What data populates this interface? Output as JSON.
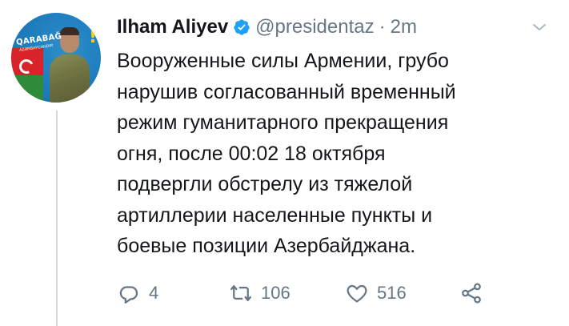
{
  "tweet": {
    "display_name": "Ilham Aliyev",
    "handle": "@presidentaz",
    "separator": "·",
    "time": "2m",
    "text_lines": [
      "Вооруженные силы Армении, грубо",
      "нарушив согласованный временный",
      "режим гуманитарного прекращения",
      "огня, после 00:02 18 октября",
      "подвергли обстрелу из тяжелой",
      "артиллерии населенные пункты и",
      "боевые позиции Азербайджана."
    ]
  },
  "avatar": {
    "banner_text": "QARABAĞ",
    "banner_sub": "AZƏRBAYCANDIR",
    "exclamation": "!"
  },
  "actions": {
    "reply_count": "4",
    "retweet_count": "106",
    "like_count": "516"
  },
  "icons": {
    "verified": "verified-badge-icon",
    "caret": "chevron-down-icon",
    "reply": "reply-icon",
    "retweet": "retweet-icon",
    "like": "heart-icon",
    "share": "share-icon"
  },
  "colors": {
    "text": "#14171a",
    "muted": "#657786",
    "verified": "#1da1f2",
    "divider": "#cfd9de"
  }
}
